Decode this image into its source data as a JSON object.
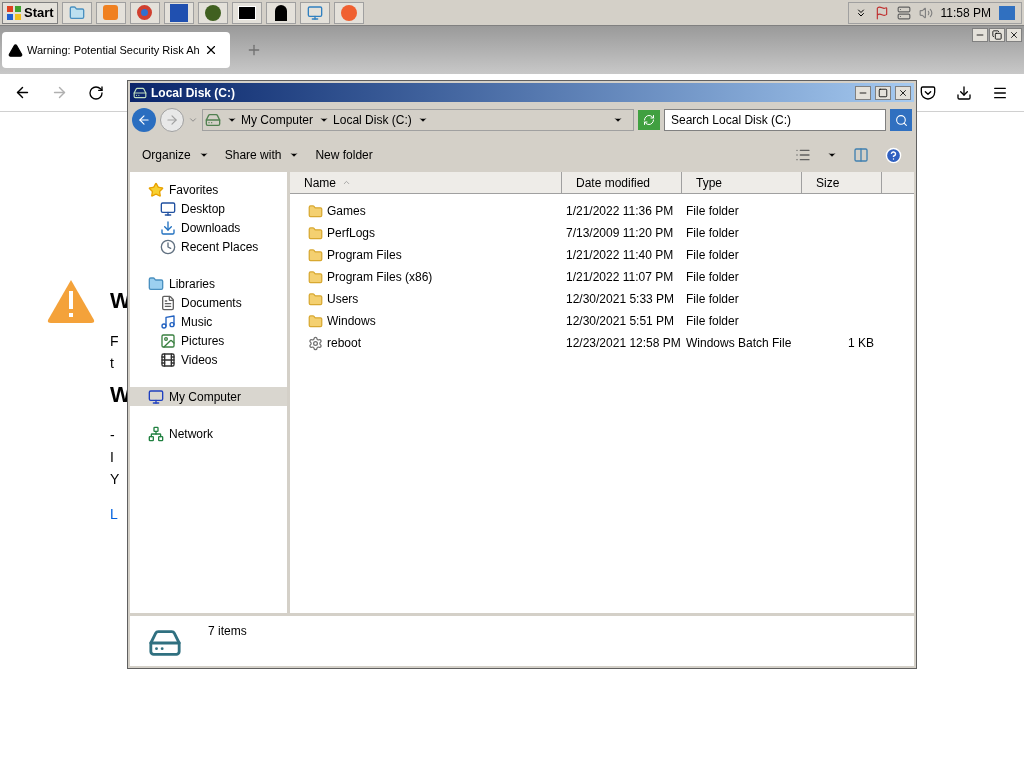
{
  "taskbar": {
    "start": "Start",
    "clock": "11:58 PM"
  },
  "browser": {
    "tab": {
      "title": "Warning: Potential Security Risk Ah",
      "selected": true
    },
    "page": [
      {
        "kind": "heading",
        "text": "W"
      },
      {
        "kind": "para",
        "text": "F"
      },
      {
        "kind": "para",
        "text": "t"
      },
      {
        "kind": "heading",
        "text": "W"
      },
      {
        "kind": "para",
        "text": "-"
      },
      {
        "kind": "para",
        "text": "I"
      },
      {
        "kind": "para",
        "text": "Y"
      },
      {
        "kind": "link",
        "text": "L"
      }
    ]
  },
  "explorer": {
    "title": "Local Disk (C:)",
    "breadcrumb": [
      "My Computer",
      "Local Disk (C:)"
    ],
    "search": {
      "placeholder": "Search Local Disk (C:)"
    },
    "toolbar": [
      {
        "label": "Organize",
        "dropdown": true
      },
      {
        "label": "Share with",
        "dropdown": true
      },
      {
        "label": "New folder",
        "dropdown": false
      }
    ],
    "nav": [
      {
        "label": "Favorites",
        "selected": false,
        "children": [
          {
            "label": "Desktop",
            "selected": false
          },
          {
            "label": "Downloads",
            "selected": false
          },
          {
            "label": "Recent Places",
            "selected": false
          }
        ]
      },
      {
        "label": "Libraries",
        "selected": false,
        "children": [
          {
            "label": "Documents",
            "selected": false
          },
          {
            "label": "Music",
            "selected": false
          },
          {
            "label": "Pictures",
            "selected": false
          },
          {
            "label": "Videos",
            "selected": false
          }
        ]
      },
      {
        "label": "My Computer",
        "selected": true
      },
      {
        "label": "Network",
        "selected": false
      }
    ],
    "columns": [
      {
        "label": "Name",
        "sorted": true
      },
      {
        "label": "Date modified",
        "sorted": false
      },
      {
        "label": "Type",
        "sorted": false
      },
      {
        "label": "Size",
        "sorted": false
      }
    ],
    "files": [
      {
        "kind": "folder",
        "name": "Games",
        "date": "1/21/2022 11:36 PM",
        "type": "File folder"
      },
      {
        "kind": "folder",
        "name": "PerfLogs",
        "date": "7/13/2009 11:20 PM",
        "type": "File folder"
      },
      {
        "kind": "folder",
        "name": "Program Files",
        "date": "1/21/2022 11:40 PM",
        "type": "File folder"
      },
      {
        "kind": "folder",
        "name": "Program Files (x86)",
        "date": "1/21/2022 11:07 PM",
        "type": "File folder"
      },
      {
        "kind": "folder",
        "name": "Users",
        "date": "12/30/2021 5:33 PM",
        "type": "File folder"
      },
      {
        "kind": "folder",
        "name": "Windows",
        "date": "12/30/2021 5:51 PM",
        "type": "File folder"
      },
      {
        "kind": "batch",
        "name": "reboot",
        "date": "12/23/2021 12:58 PM",
        "type": "Windows Batch File",
        "size": "1 KB"
      }
    ],
    "status": "7 items"
  }
}
